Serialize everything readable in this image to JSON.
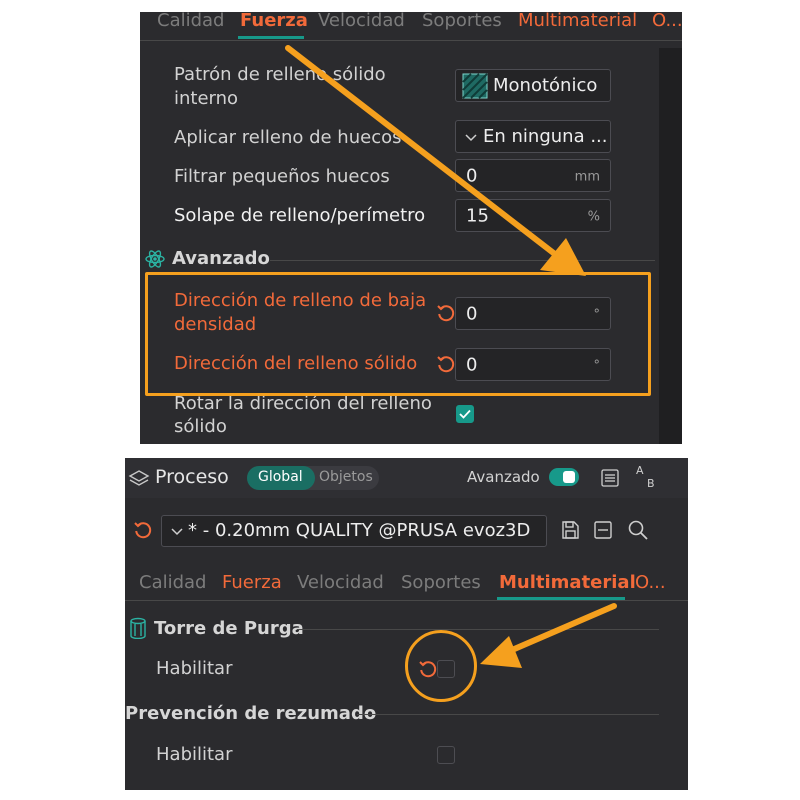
{
  "top": {
    "tabs": [
      "Calidad",
      "Fuerza",
      "Velocidad",
      "Soportes",
      "Multimaterial",
      "O..."
    ],
    "rows": {
      "pattern_label_1": "Patrón de relleno sólido",
      "pattern_label_2": "interno",
      "pattern_value": "Monotónico",
      "gap_label": "Aplicar relleno de huecos",
      "gap_value": "En ninguna ...",
      "filter_label": "Filtrar pequeños huecos",
      "filter_value": "0",
      "filter_unit": "mm",
      "overlap_label": "Solape de relleno/perímetro",
      "overlap_value": "15",
      "overlap_unit": "%"
    },
    "advanced": {
      "title": "Avanzado",
      "sparse_label_1": "Dirección de relleno de baja",
      "sparse_label_2": "densidad",
      "sparse_value": "0",
      "sparse_unit": "°",
      "solid_label": "Dirección del relleno sólido",
      "solid_value": "0",
      "solid_unit": "°",
      "rotate_label_1": "Rotar la dirección del relleno",
      "rotate_label_2": "sólido"
    }
  },
  "bottom": {
    "title": "Proceso",
    "toggle_global": "Global",
    "toggle_objects": "Objetos",
    "advanced_label": "Avanzado",
    "compare_icon_text": [
      "A",
      "B"
    ],
    "preset": "* - 0.20mm QUALITY @PRUSA evoz3D",
    "tabs": [
      "Calidad",
      "Fuerza",
      "Velocidad",
      "Soportes",
      "Multimaterial",
      "O..."
    ],
    "prime_tower_title": "Torre de Purga",
    "enable_label_1": "Habilitar",
    "ooze_title": "Prevención de rezumado",
    "enable_label_2": "Habilitar"
  },
  "colors": {
    "accent_orange": "#f26a3a",
    "annotation_orange": "#f5a01e",
    "teal": "#17998a",
    "panel_bg": "#2b2b2e"
  }
}
